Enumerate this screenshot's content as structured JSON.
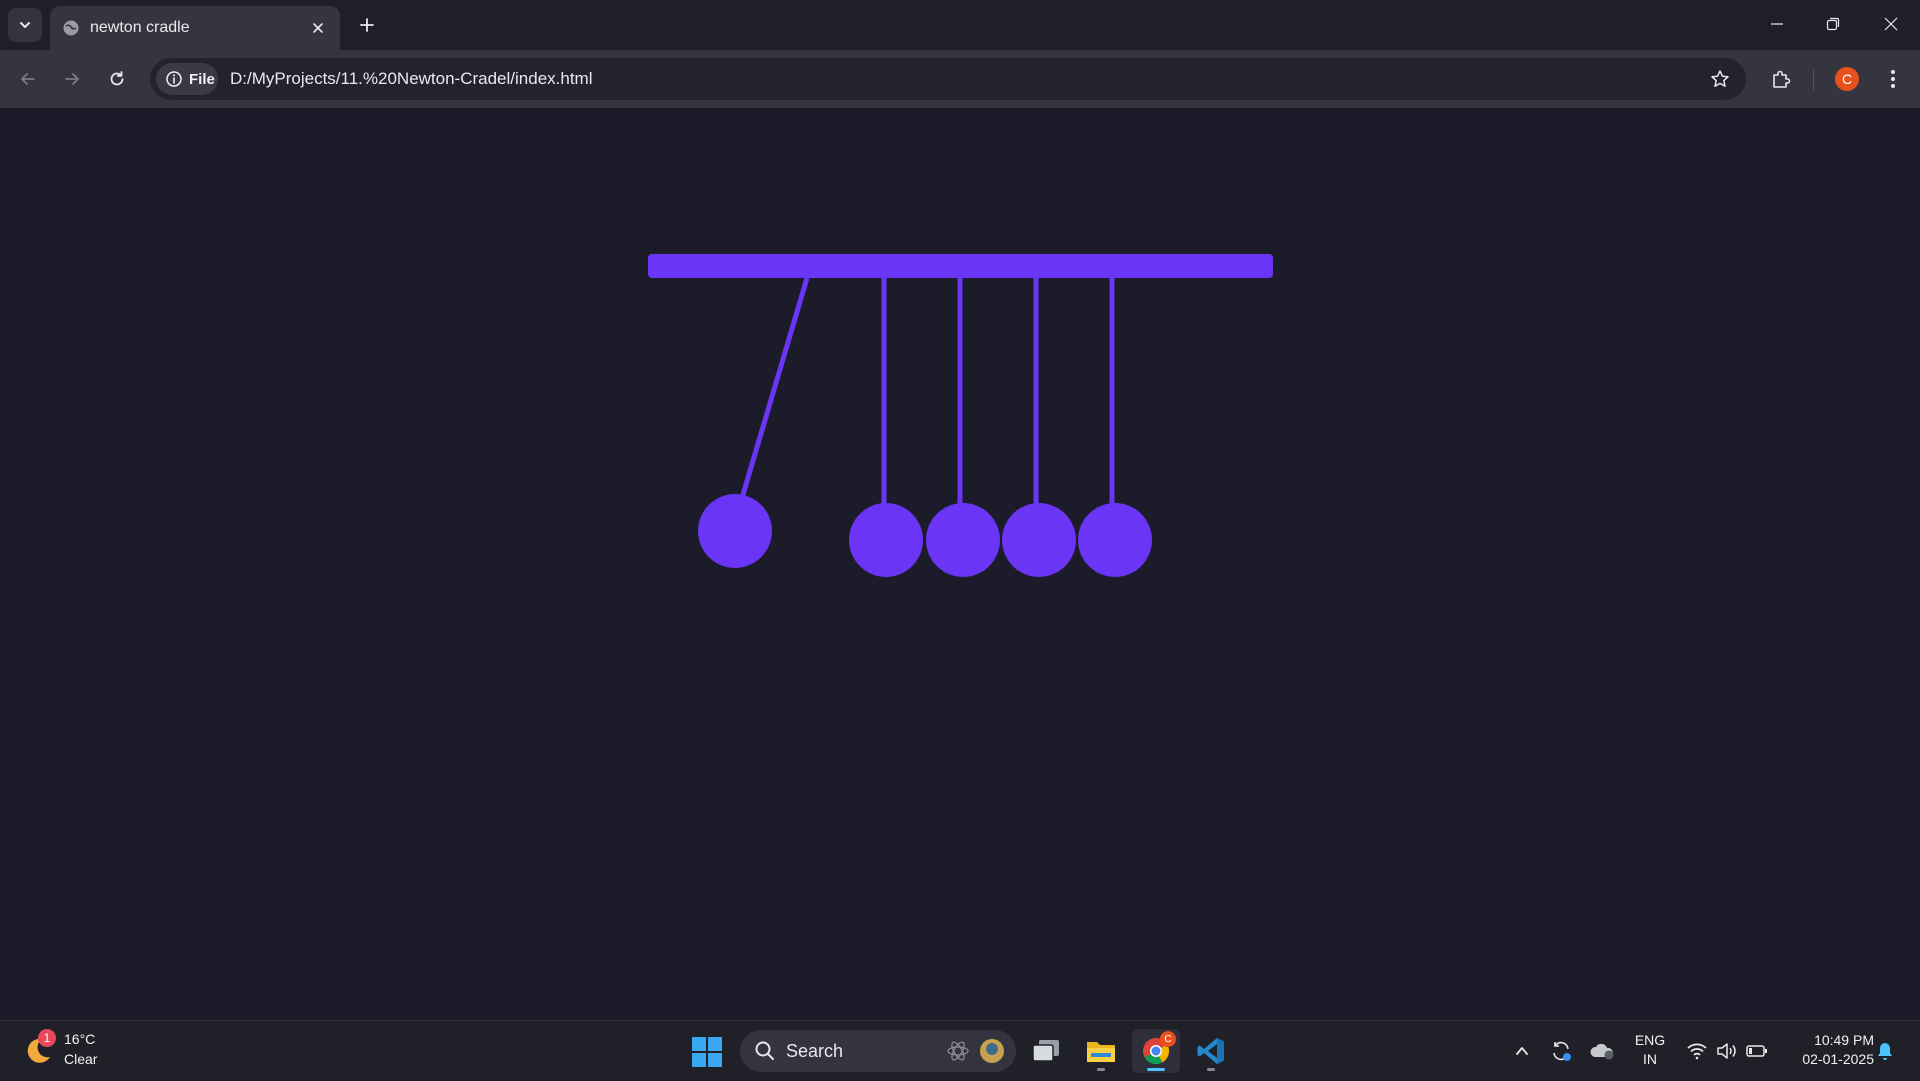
{
  "browser": {
    "tab": {
      "title": "newton cradle"
    },
    "omnibox": {
      "site_chip_label": "File",
      "url": "D:/MyProjects/11.%20Newton-Cradel/index.html"
    },
    "profile_initial": "C"
  },
  "cradle": {
    "color": "#6a35f5",
    "background": "#1c1b2a",
    "ball_count": 5,
    "swinging_ball_index": 0
  },
  "taskbar": {
    "weather": {
      "badge": "1",
      "temperature": "16°C",
      "condition": "Clear"
    },
    "search": {
      "label": "Search"
    },
    "apps": [
      "task-view",
      "file-explorer",
      "chrome",
      "vscode"
    ],
    "chrome_badge": "C",
    "language": {
      "line1": "ENG",
      "line2": "IN"
    },
    "clock": {
      "time": "10:49 PM",
      "date": "02-01-2025"
    }
  }
}
